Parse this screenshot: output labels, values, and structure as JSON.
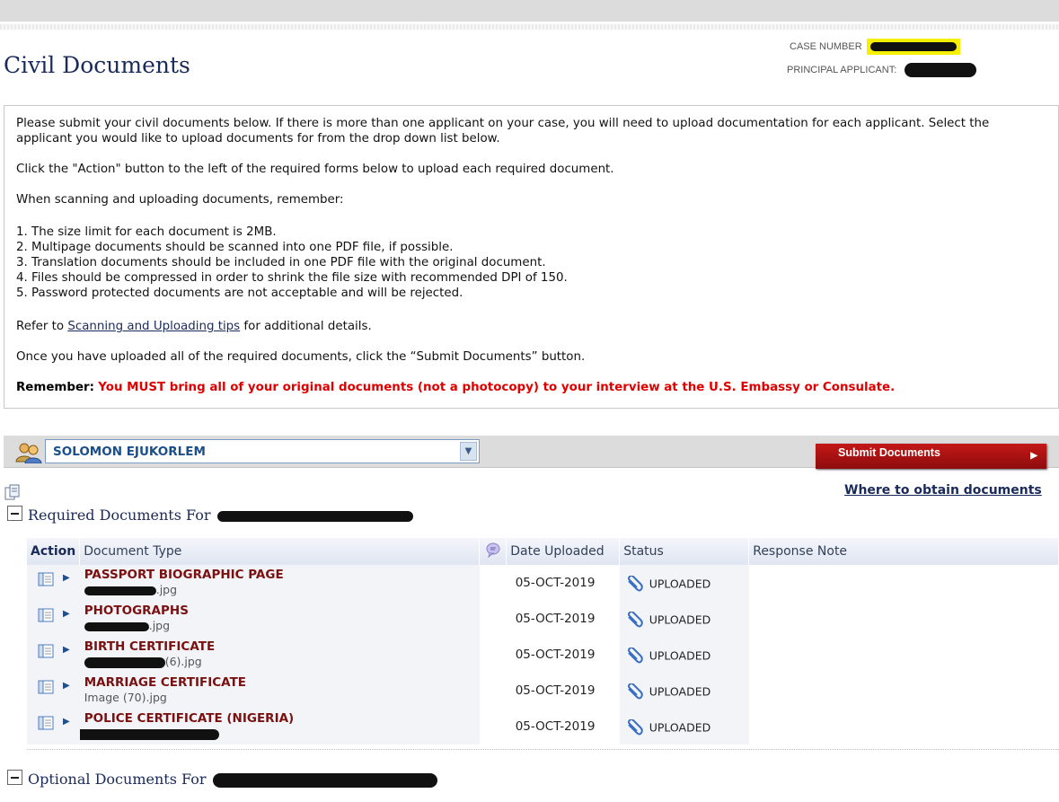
{
  "page": {
    "title": "Civil Documents",
    "case_number_label": "CASE NUMBER",
    "principal_applicant_label": "PRINCIPAL APPLICANT:"
  },
  "intro": {
    "p1": "Please submit your civil documents below. If there is more than one applicant on your case, you will need to upload documentation for each applicant. Select the applicant you would like to upload documents for from the drop down list below.",
    "p2": "Click the \"Action\" button to the left of the required forms below to upload each required document.",
    "p3": "When scanning and uploading documents, remember:",
    "rules": [
      "1. The size limit for each document is 2MB.",
      "2. Multipage documents should be scanned into one PDF file, if possible.",
      "3. Translation documents should be included in one PDF file with the original document.",
      "4. Files should be compressed in order to shrink the file size with recommended DPI of 150.",
      "5. Password protected documents are not acceptable and will be rejected."
    ],
    "refer_prefix": "Refer to ",
    "refer_link": "Scanning and Uploading tips",
    "refer_suffix": " for additional details.",
    "p5": "Once you have uploaded all of the required documents, click the “Submit Documents” button.",
    "remember_label": "Remember:",
    "remember_text": "You MUST bring all of your original documents (not a photocopy) to your interview at the U.S. Embassy or Consulate."
  },
  "selector": {
    "selected_applicant": "SOLOMON EJUKORLEM",
    "submit_label": "Submit Documents"
  },
  "links": {
    "where_to_obtain": "Where to obtain documents"
  },
  "sections": {
    "required_title": "Required Documents For",
    "optional_title": "Optional Documents For"
  },
  "table": {
    "headers": {
      "action": "Action",
      "document_type": "Document Type",
      "date_uploaded": "Date Uploaded",
      "status": "Status",
      "response_note": "Response Note"
    },
    "rows": [
      {
        "name": "PASSPORT BIOGRAPHIC PAGE",
        "file": ".jpg",
        "date": "05-OCT-2019",
        "status": "UPLOADED"
      },
      {
        "name": "PHOTOGRAPHS",
        "file": ".jpg",
        "date": "05-OCT-2019",
        "status": "UPLOADED"
      },
      {
        "name": "BIRTH CERTIFICATE",
        "file": "(6).jpg",
        "date": "05-OCT-2019",
        "status": "UPLOADED"
      },
      {
        "name": "MARRIAGE CERTIFICATE",
        "file": "Image (70).jpg",
        "date": "05-OCT-2019",
        "status": "UPLOADED"
      },
      {
        "name": "POLICE CERTIFICATE (NIGERIA)",
        "file": "",
        "date": "05-OCT-2019",
        "status": "UPLOADED"
      }
    ]
  },
  "colors": {
    "title_navy": "#1a2a5a",
    "warning_red": "#e00000",
    "doc_name_maroon": "#7a1010",
    "submit_red": "#b01414"
  }
}
